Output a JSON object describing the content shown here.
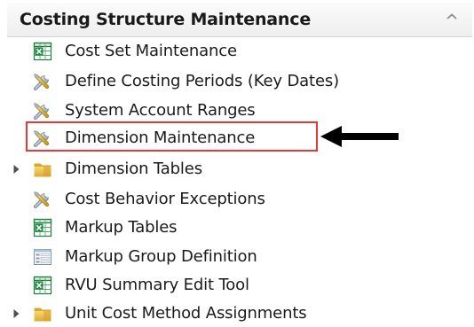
{
  "panel": {
    "title": "Costing Structure Maintenance"
  },
  "tree": {
    "items": [
      {
        "label": "Cost Set Maintenance",
        "icon": "spreadsheet-icon",
        "expandable": false
      },
      {
        "label": "Define Costing Periods (Key Dates)",
        "icon": "tools-icon",
        "expandable": false
      },
      {
        "label": "System Account Ranges",
        "icon": "tools-icon",
        "expandable": false
      },
      {
        "label": "Dimension Maintenance",
        "icon": "tools-icon",
        "expandable": false,
        "highlighted": true
      },
      {
        "label": "Dimension Tables",
        "icon": "folder-icon",
        "expandable": true
      },
      {
        "label": "Cost Behavior Exceptions",
        "icon": "tools-icon",
        "expandable": false
      },
      {
        "label": "Markup Tables",
        "icon": "spreadsheet-icon",
        "expandable": false
      },
      {
        "label": "Markup Group Definition",
        "icon": "form-icon",
        "expandable": false
      },
      {
        "label": "RVU Summary Edit Tool",
        "icon": "spreadsheet-icon",
        "expandable": false
      },
      {
        "label": "Unit Cost Method Assignments",
        "icon": "folder-icon",
        "expandable": true
      }
    ]
  },
  "annotation": {
    "highlight_color": "#e53838",
    "arrow_color": "#000000"
  }
}
